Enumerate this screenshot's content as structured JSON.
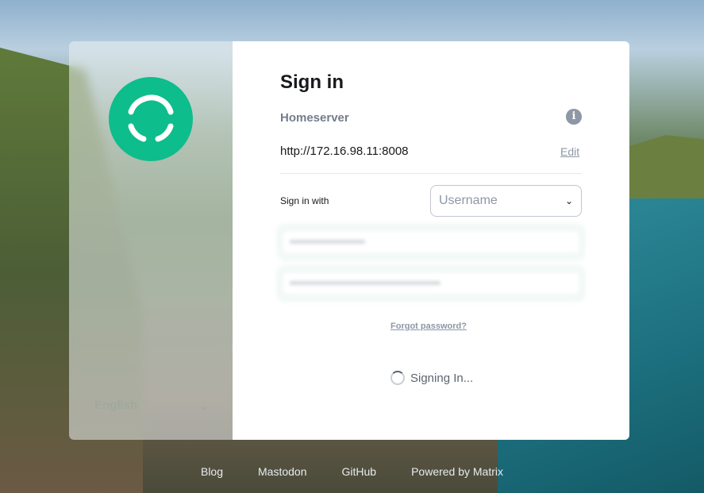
{
  "sidebar": {
    "language": "English"
  },
  "form": {
    "title": "Sign in",
    "homeserver_label": "Homeserver",
    "homeserver_url": "http://172.16.98.11:8008",
    "edit_label": "Edit",
    "sign_in_with_label": "Sign in with",
    "sign_in_with_value": "Username",
    "forgot_password": "Forgot password?",
    "status": "Signing In..."
  },
  "footer": {
    "links": [
      "Blog",
      "Mastodon",
      "GitHub",
      "Powered by Matrix"
    ]
  },
  "colors": {
    "brand": "#0dbd8b"
  }
}
